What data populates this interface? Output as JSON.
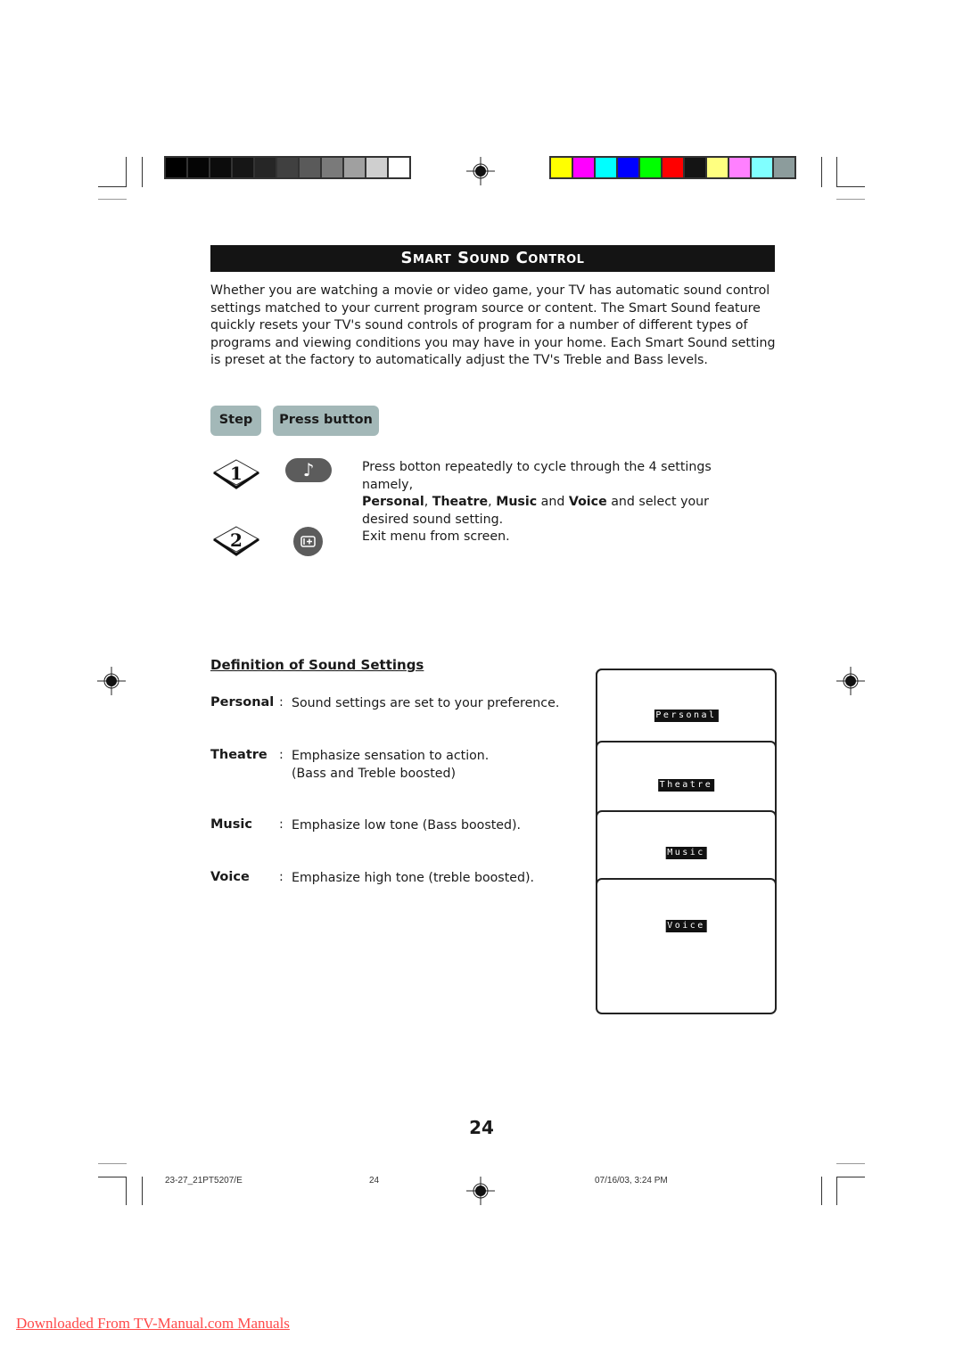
{
  "header": {
    "title": "Smart Sound Control"
  },
  "color_bars": {
    "grayscale": [
      "#000000",
      "#050505",
      "#0c0c0c",
      "#161616",
      "#262626",
      "#404040",
      "#5a5a5a",
      "#7a7a7a",
      "#a0a0a0",
      "#cfcfcf",
      "#ffffff"
    ],
    "colors": [
      "#ffff00",
      "#ff00ff",
      "#00ffff",
      "#0000ff",
      "#00ff00",
      "#ff0000",
      "#141414",
      "#ffff80",
      "#ff80ff",
      "#80ffff",
      "#8c9c9c"
    ]
  },
  "intro": {
    "text": "Whether you are watching a movie or video game, your TV has automatic sound control settings matched to your current program source or content. The Smart Sound feature quickly resets your TV's sound controls of program for a number of different types of programs and viewing conditions you may have in your home. Each Smart Sound setting is preset at the factory to automatically adjust the TV's Treble and Bass levels."
  },
  "steps_header": {
    "step_label": "Step",
    "press_label": "Press button"
  },
  "steps": [
    {
      "number": "1",
      "button_icon": "music-note-icon",
      "button_glyph": "♪",
      "text_intro": "Press botton repeatedly to cycle through the 4 settings namely,",
      "settings": [
        "Personal",
        "Theatre",
        "Music",
        "Voice"
      ],
      "sep_comma": ", ",
      "sep_and": " and ",
      "text_outro": " and select your desired sound setting."
    },
    {
      "number": "2",
      "button_icon": "exit-menu-icon",
      "text": "Exit menu from screen."
    }
  ],
  "definitions": {
    "heading": "Definition of Sound Settings",
    "colon": ":",
    "items": [
      {
        "term": "Personal",
        "desc": "Sound settings are set to your preference.",
        "desc2": ""
      },
      {
        "term": "Theatre",
        "desc": "Emphasize sensation to action.",
        "desc2": "(Bass and Treble boosted)"
      },
      {
        "term": "Music",
        "desc": "Emphasize low tone (Bass boosted).",
        "desc2": ""
      },
      {
        "term": "Voice",
        "desc": "Emphasize high tone (treble boosted).",
        "desc2": ""
      }
    ]
  },
  "osd_panels": [
    "Personal",
    "Theatre",
    "Music",
    "Voice"
  ],
  "footer": {
    "page_number": "24",
    "slug_file": "23-27_21PT5207/E",
    "slug_page": "24",
    "slug_date": "07/16/03, 3:24 PM",
    "download_link": "Downloaded From TV-Manual.com Manuals"
  }
}
